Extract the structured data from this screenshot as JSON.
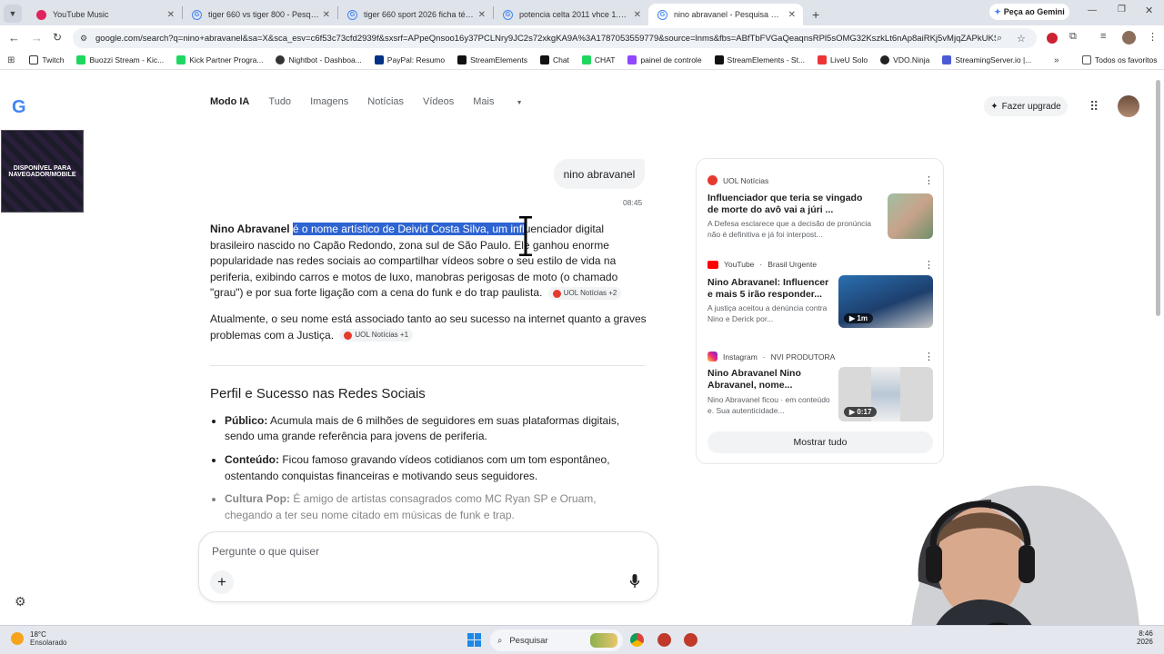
{
  "tabs": [
    {
      "title": "YouTube Music",
      "color": "#e0245e"
    },
    {
      "title": "tiger 660 vs tiger 800 - Pesquisa",
      "color": "#4285f4"
    },
    {
      "title": "tiger 660 sport 2026 ficha técnica",
      "color": "#4285f4"
    },
    {
      "title": "potencia celta 2011 vhce 1.0 - Pes",
      "color": "#4285f4"
    },
    {
      "title": "nino abravanel - Pesquisa Google",
      "color": "#4285f4"
    }
  ],
  "gemini_button": "Peça ao Gemini",
  "url": "google.com/search?q=nino+abravanel&sa=X&sca_esv=c6f53c73cfd2939f&sxsrf=APpeQnsoo16y37PCLNry9JC2s72xkgKA9A%3A1787053559779&source=lnms&fbs=ABfTbFVGaQeaqnsRPl5sOMG32KszkLt6nAp8aiRKj5vMjqZAPkUKSutr57...",
  "bookmarks": [
    "Twitch",
    "Buozzi Stream - Kic...",
    "Kick Partner Progra...",
    "Nightbot - Dashboa...",
    "PayPal: Resumo",
    "StreamElements",
    "Chat",
    "CHAT",
    "painel de controle",
    "StreamElements - St...",
    "LiveU Solo",
    "VDO.Ninja",
    "StreamingServer.io |..."
  ],
  "bookmarks_all": "Todos os favoritos",
  "nav": [
    "Modo IA",
    "Tudo",
    "Imagens",
    "Notícias",
    "Vídeos",
    "Mais"
  ],
  "upgrade_button": "Fazer upgrade",
  "overlay_text": "DISPONÍVEL PARA NAVEGADOR/MOBILE",
  "query": "nino abravanel",
  "query_time": "08:45",
  "answer": {
    "p1_bold": "Nino Abravanel",
    "p1_highlight": "é o nome artístico de Deivid Costa Silva, um infl",
    "p1_rest": "uenciador digital brasileiro nascido no Capão Redondo, zona sul de São Paulo. Ele ganhou enorme popularidade nas redes sociais ao compartilhar vídeos sobre o seu estilo de vida na periferia, exibindo carros e motos de luxo, manobras perigosas de moto (o chamado \"grau\") e por sua forte ligação com a cena do funk e do trap paulista.",
    "p1_cite": "UOL Notícias +2",
    "p2": "Atualmente, o seu nome está associado tanto ao seu sucesso na internet quanto a graves problemas com a Justiça.",
    "p2_cite": "UOL Notícias +1",
    "heading": "Perfil e Sucesso nas Redes Sociais",
    "bullets": [
      {
        "label": "Público:",
        "text": "Acumula mais de 6 milhões de seguidores em suas plataformas digitais, sendo uma grande referência para jovens de periferia."
      },
      {
        "label": "Conteúdo:",
        "text": "Ficou famoso gravando vídeos cotidianos com um tom espontâneo, ostentando conquistas financeiras e motivando seus seguidores."
      },
      {
        "label": "Cultura Pop:",
        "text": "É amigo de artistas consagrados como MC Ryan SP e Oruam, chegando a ter seu nome citado em músicas de funk e trap."
      }
    ]
  },
  "ask_placeholder": "Pergunte o que quiser",
  "sources": [
    {
      "source": "UOL Notícias",
      "sub": "",
      "title": "Influenciador que teria se vingado de morte do avô vai a júri ...",
      "desc": "A Defesa esclarece que a decisão de pronúncia não é definitiva e já foi interpost...",
      "duration": ""
    },
    {
      "source": "YouTube",
      "sub": "Brasil Urgente",
      "title": "Nino Abravanel: Influencer e mais 5 irão responder...",
      "desc": "A justiça aceitou a denúncia contra Nino e Derick por...",
      "duration": "1m"
    },
    {
      "source": "Instagram",
      "sub": "NVI PRODUTORA",
      "title": "Nino Abravanel Nino Abravanel, nome...",
      "desc": "Nino Abravanel ficou · em conteúdo e. Sua autenticidade...",
      "duration": "0:17"
    }
  ],
  "show_all": "Mostrar tudo",
  "weather": {
    "temp": "18°C",
    "cond": "Ensolarado"
  },
  "taskbar_search": "Pesquisar",
  "clock": {
    "time": "8:46",
    "year": "2026"
  }
}
